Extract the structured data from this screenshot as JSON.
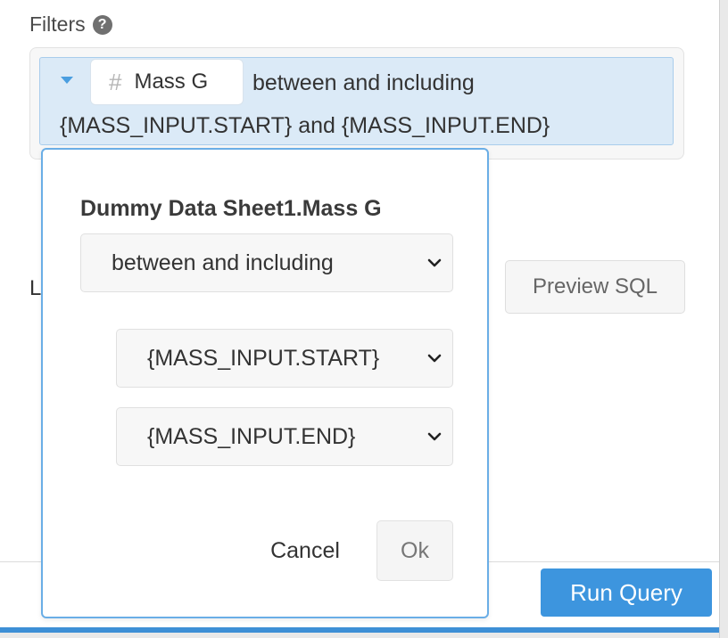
{
  "filters": {
    "label": "Filters",
    "help_icon": "question-circle-icon",
    "field_icon": "hash-icon",
    "field_name": "Mass G",
    "operator_text": "between and including",
    "value_text": "{MASS_INPUT.START} and {MASS_INPUT.END}"
  },
  "background": {
    "partial_label": "L",
    "preview_label": "Preview SQL",
    "run_label": "Run Query"
  },
  "popover": {
    "title": "Dummy Data Sheet1.Mass G",
    "operator_value": "between and including",
    "start_value": "{MASS_INPUT.START}",
    "end_value": "{MASS_INPUT.END}",
    "cancel_label": "Cancel",
    "ok_label": "Ok",
    "chevron_icon": "chevron-down-icon"
  },
  "colors": {
    "accent": "#3d95de",
    "pill_bg": "#dbeaf7",
    "pill_border": "#a9cdec",
    "popover_border": "#6aaee6"
  }
}
